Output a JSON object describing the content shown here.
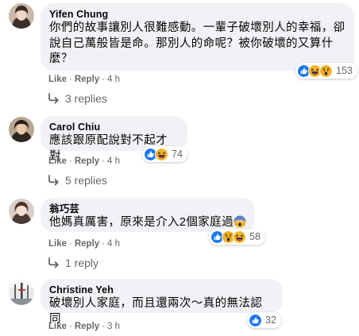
{
  "comments": [
    {
      "name": "Yifen Chung",
      "text_line1": "你們的故事讓別人很難感動。一輩子破壞別人的幸福，卻",
      "text_line2": "說自己萬般皆是命。那別人的命呢？被你破壞的又算什",
      "text_line3": "麼？",
      "like": "Like",
      "reply": "Reply",
      "time": "4 h",
      "reaction_count": "153",
      "reactions": [
        "like-icon",
        "haha-icon",
        "wow-icon"
      ],
      "replies_label": "3 replies"
    },
    {
      "name": "Carol Chiu",
      "text_line1": "應該跟原配說對不起才對",
      "like": "Like",
      "reply": "Reply",
      "time": "4 h",
      "reaction_count": "74",
      "reactions": [
        "like-icon",
        "haha-icon"
      ],
      "replies_label": "5 replies"
    },
    {
      "name": "翁巧芸",
      "text_line1": "他媽真厲害，原來是介入2個家庭過",
      "inline_emoji": "scream-emoji-icon",
      "like": "Like",
      "reply": "Reply",
      "time": "4 h",
      "reaction_count": "58",
      "reactions": [
        "like-icon",
        "wow-icon",
        "haha-icon"
      ],
      "replies_label": "1 reply"
    },
    {
      "name": "Christine Yeh",
      "text_line1": "破壞別人家庭，而且還兩次～真的無法認同",
      "like": "Like",
      "reply": "Reply",
      "time": "3 h",
      "reaction_count": "32",
      "reactions": [
        "like-icon"
      ]
    }
  ],
  "colors": {
    "bubble": "#f0f2f5",
    "secondary_text": "#65676b",
    "like_blue": "#1877f2",
    "reaction_yellow": "#f7b125"
  }
}
